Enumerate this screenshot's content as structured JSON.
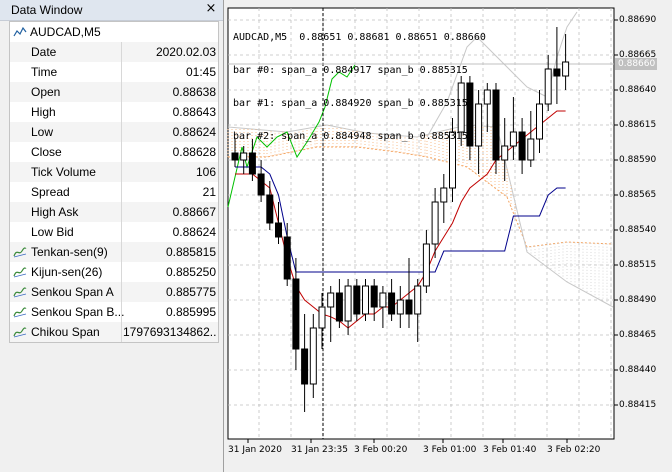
{
  "data_window": {
    "title": "Data Window",
    "close_glyph": "×",
    "symbol": "AUDCAD,M5",
    "rows": [
      {
        "label": "Date",
        "value": "2020.02.03"
      },
      {
        "label": "Time",
        "value": "01:45"
      },
      {
        "label": "Open",
        "value": "0.88638"
      },
      {
        "label": "High",
        "value": "0.88643"
      },
      {
        "label": "Low",
        "value": "0.88624"
      },
      {
        "label": "Close",
        "value": "0.88628"
      },
      {
        "label": "Tick Volume",
        "value": "106"
      },
      {
        "label": "Spread",
        "value": "21"
      },
      {
        "label": "High Ask",
        "value": "0.88667"
      },
      {
        "label": "Low Bid",
        "value": "0.88624"
      },
      {
        "label": "Tenkan-sen(9)",
        "value": "0.885815",
        "icon": "indicator-icon"
      },
      {
        "label": "Kijun-sen(26)",
        "value": "0.885250",
        "icon": "indicator-icon"
      },
      {
        "label": "Senkou Span A",
        "value": "0.885775",
        "icon": "indicator-icon"
      },
      {
        "label": "Senkou Span B...",
        "value": "0.885995",
        "icon": "indicator-icon"
      },
      {
        "label": "Chikou Span",
        "value": "1797693134862...",
        "icon": "indicator-icon"
      }
    ]
  },
  "chart": {
    "header_lines": [
      "AUDCAD,M5  0.88651 0.88681 0.88651 0.88660",
      "bar #0: span_a 0.884917 span_b 0.885315",
      "bar #1: span_a 0.884920 span_b 0.885315",
      "bar #2: span_a 0.884948 span_b 0.885315"
    ],
    "current_price": "0.88660",
    "y_ticks": [
      "0.88690",
      "0.88665",
      "0.88640",
      "0.88615",
      "0.88590",
      "0.88565",
      "0.88540",
      "0.88515",
      "0.88490",
      "0.88465",
      "0.88440",
      "0.88415"
    ],
    "x_ticks": [
      "31 Jan 2020",
      "31 Jan 23:35",
      "3 Feb 00:20",
      "3 Feb 01:00",
      "3 Feb 01:40",
      "3 Feb 02:20"
    ],
    "colors": {
      "tenkan": "#c00000",
      "kijun": "#00008b",
      "chikou": "#00c000",
      "span_a": "#f4a460",
      "span_b": "#c8c8c8",
      "candle_bull": "#ffffff",
      "candle_bear": "#000000",
      "grid": "#c0c0c0"
    }
  },
  "chart_data": {
    "type": "candlestick",
    "symbol": "AUDCAD,M5",
    "y_range": [
      0.884,
      0.887
    ],
    "candles": [
      {
        "o": 0.88595,
        "h": 0.88605,
        "l": 0.88585,
        "c": 0.8859
      },
      {
        "o": 0.8859,
        "h": 0.886,
        "l": 0.8858,
        "c": 0.88595
      },
      {
        "o": 0.88595,
        "h": 0.88605,
        "l": 0.88575,
        "c": 0.8858
      },
      {
        "o": 0.8858,
        "h": 0.8859,
        "l": 0.8856,
        "c": 0.88565
      },
      {
        "o": 0.88565,
        "h": 0.88575,
        "l": 0.8854,
        "c": 0.88545
      },
      {
        "o": 0.88545,
        "h": 0.8856,
        "l": 0.8853,
        "c": 0.88535
      },
      {
        "o": 0.88535,
        "h": 0.88545,
        "l": 0.885,
        "c": 0.88505
      },
      {
        "o": 0.88505,
        "h": 0.8852,
        "l": 0.8844,
        "c": 0.88455
      },
      {
        "o": 0.88455,
        "h": 0.8848,
        "l": 0.8841,
        "c": 0.8843
      },
      {
        "o": 0.8843,
        "h": 0.8848,
        "l": 0.8842,
        "c": 0.8847
      },
      {
        "o": 0.8847,
        "h": 0.88495,
        "l": 0.88455,
        "c": 0.88485
      },
      {
        "o": 0.88485,
        "h": 0.885,
        "l": 0.8846,
        "c": 0.88495
      },
      {
        "o": 0.88495,
        "h": 0.88505,
        "l": 0.8847,
        "c": 0.88475
      },
      {
        "o": 0.88475,
        "h": 0.88505,
        "l": 0.88465,
        "c": 0.885
      },
      {
        "o": 0.885,
        "h": 0.88505,
        "l": 0.88475,
        "c": 0.8848
      },
      {
        "o": 0.8848,
        "h": 0.88505,
        "l": 0.88475,
        "c": 0.885
      },
      {
        "o": 0.885,
        "h": 0.88505,
        "l": 0.88475,
        "c": 0.88485
      },
      {
        "o": 0.88485,
        "h": 0.885,
        "l": 0.8847,
        "c": 0.88495
      },
      {
        "o": 0.88495,
        "h": 0.88505,
        "l": 0.88475,
        "c": 0.8848
      },
      {
        "o": 0.8848,
        "h": 0.885,
        "l": 0.8847,
        "c": 0.8849
      },
      {
        "o": 0.8849,
        "h": 0.8852,
        "l": 0.8847,
        "c": 0.8848
      },
      {
        "o": 0.8848,
        "h": 0.88505,
        "l": 0.8846,
        "c": 0.885
      },
      {
        "o": 0.885,
        "h": 0.8854,
        "l": 0.88495,
        "c": 0.8853
      },
      {
        "o": 0.8853,
        "h": 0.8857,
        "l": 0.8852,
        "c": 0.8856
      },
      {
        "o": 0.8856,
        "h": 0.8858,
        "l": 0.88545,
        "c": 0.8857
      },
      {
        "o": 0.8857,
        "h": 0.8862,
        "l": 0.8856,
        "c": 0.8861
      },
      {
        "o": 0.8861,
        "h": 0.8865,
        "l": 0.886,
        "c": 0.88645
      },
      {
        "o": 0.88645,
        "h": 0.8865,
        "l": 0.8859,
        "c": 0.886
      },
      {
        "o": 0.886,
        "h": 0.8864,
        "l": 0.8858,
        "c": 0.8863
      },
      {
        "o": 0.8863,
        "h": 0.88645,
        "l": 0.8861,
        "c": 0.8864
      },
      {
        "o": 0.8864,
        "h": 0.88645,
        "l": 0.8858,
        "c": 0.8859
      },
      {
        "o": 0.8859,
        "h": 0.8862,
        "l": 0.88575,
        "c": 0.886
      },
      {
        "o": 0.886,
        "h": 0.88635,
        "l": 0.8859,
        "c": 0.8861
      },
      {
        "o": 0.8861,
        "h": 0.8862,
        "l": 0.8858,
        "c": 0.8859
      },
      {
        "o": 0.8859,
        "h": 0.88625,
        "l": 0.88585,
        "c": 0.88605
      },
      {
        "o": 0.88605,
        "h": 0.8864,
        "l": 0.88595,
        "c": 0.8863
      },
      {
        "o": 0.8863,
        "h": 0.88665,
        "l": 0.88625,
        "c": 0.88655
      },
      {
        "o": 0.88655,
        "h": 0.88685,
        "l": 0.8863,
        "c": 0.8865
      },
      {
        "o": 0.8865,
        "h": 0.8868,
        "l": 0.8864,
        "c": 0.8866
      }
    ],
    "tenkan": [
      0.8858,
      0.8858,
      0.8858,
      0.88575,
      0.8857,
      0.88545,
      0.8852,
      0.885,
      0.8849,
      0.88485,
      0.8848,
      0.88478,
      0.88475,
      0.8847,
      0.88475,
      0.8848,
      0.8848,
      0.88485,
      0.88485,
      0.8849,
      0.88495,
      0.885,
      0.8851,
      0.88525,
      0.88535,
      0.88545,
      0.8856,
      0.8857,
      0.88575,
      0.8858,
      0.8859,
      0.88595,
      0.886,
      0.88605,
      0.8861,
      0.88615,
      0.8862,
      0.88625,
      0.88625
    ],
    "kijun": [
      0.88585,
      0.88585,
      0.88585,
      0.88585,
      0.8858,
      0.88565,
      0.88535,
      0.8851,
      0.8851,
      0.8851,
      0.8851,
      0.8851,
      0.8851,
      0.8851,
      0.8851,
      0.8851,
      0.8851,
      0.8851,
      0.8851,
      0.8851,
      0.8851,
      0.8851,
      0.8851,
      0.8851,
      0.88525,
      0.88525,
      0.88525,
      0.88525,
      0.88525,
      0.88525,
      0.88525,
      0.88525,
      0.8855,
      0.8855,
      0.8855,
      0.8855,
      0.88565,
      0.8857,
      0.8857
    ]
  }
}
